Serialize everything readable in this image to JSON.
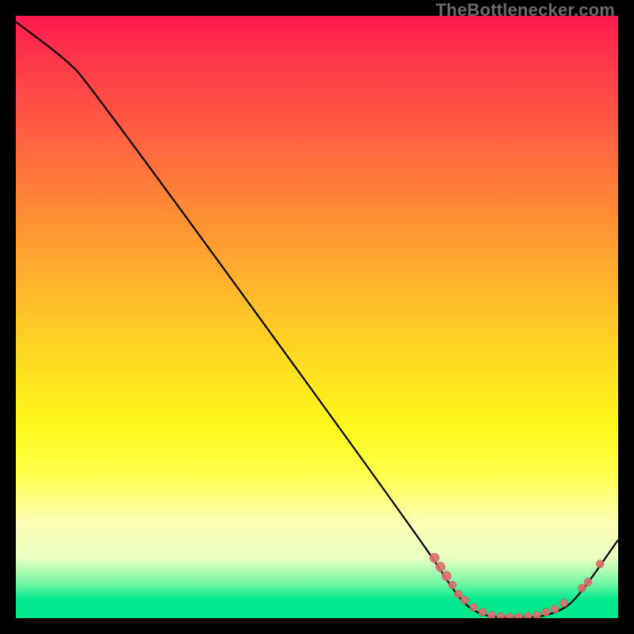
{
  "watermark": "TheBottlenecker.com",
  "colors": {
    "curve": "#000000",
    "marker_fill": "#e26d6d",
    "marker_stroke": "#c24d4d",
    "frame": "#000000"
  },
  "chart_data": {
    "type": "line",
    "title": "",
    "xlabel": "",
    "ylabel": "",
    "xlim": [
      0,
      100
    ],
    "ylim": [
      0,
      100
    ],
    "grid": false,
    "curve": [
      {
        "x": 0,
        "y": 99
      },
      {
        "x": 8,
        "y": 93
      },
      {
        "x": 12,
        "y": 89
      },
      {
        "x": 68,
        "y": 12
      },
      {
        "x": 73,
        "y": 4
      },
      {
        "x": 76,
        "y": 1
      },
      {
        "x": 80,
        "y": 0
      },
      {
        "x": 86,
        "y": 0
      },
      {
        "x": 90,
        "y": 1
      },
      {
        "x": 93,
        "y": 3
      },
      {
        "x": 100,
        "y": 13
      }
    ],
    "markers": [
      {
        "x": 69.5,
        "y": 10.0,
        "r": 6
      },
      {
        "x": 70.5,
        "y": 8.5,
        "r": 6
      },
      {
        "x": 71.5,
        "y": 7.0,
        "r": 6
      },
      {
        "x": 72.5,
        "y": 5.5,
        "r": 5
      },
      {
        "x": 73.5,
        "y": 4.0,
        "r": 5
      },
      {
        "x": 74.5,
        "y": 3.0,
        "r": 5
      },
      {
        "x": 76.0,
        "y": 1.8,
        "r": 5
      },
      {
        "x": 77.5,
        "y": 1.0,
        "r": 5
      },
      {
        "x": 79.0,
        "y": 0.5,
        "r": 5
      },
      {
        "x": 80.5,
        "y": 0.3,
        "r": 5
      },
      {
        "x": 82.0,
        "y": 0.2,
        "r": 5
      },
      {
        "x": 83.5,
        "y": 0.2,
        "r": 5
      },
      {
        "x": 85.0,
        "y": 0.3,
        "r": 5
      },
      {
        "x": 86.5,
        "y": 0.5,
        "r": 5
      },
      {
        "x": 88.0,
        "y": 1.0,
        "r": 5
      },
      {
        "x": 89.5,
        "y": 1.5,
        "r": 5
      },
      {
        "x": 91.0,
        "y": 2.5,
        "r": 5
      },
      {
        "x": 94.0,
        "y": 5.0,
        "r": 5
      },
      {
        "x": 95.0,
        "y": 6.0,
        "r": 5
      },
      {
        "x": 97.0,
        "y": 9.0,
        "r": 5
      }
    ],
    "annotations": []
  }
}
